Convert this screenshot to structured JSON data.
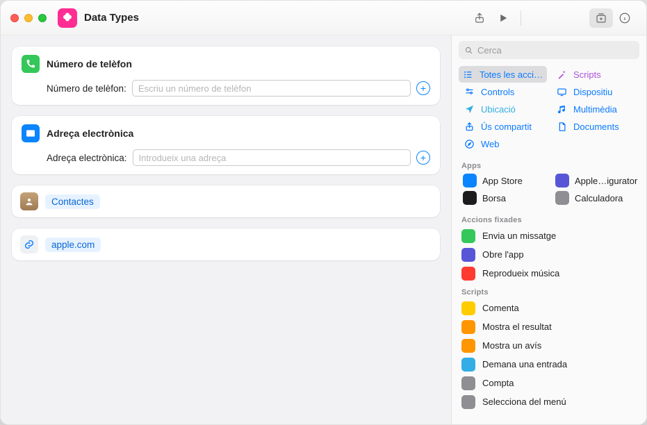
{
  "window": {
    "title": "Data Types"
  },
  "cards": {
    "phone": {
      "title": "Número de telèfon",
      "field_label": "Número de telèfon:",
      "placeholder": "Escriu un número de telèfon"
    },
    "email": {
      "title": "Adreça electrònica",
      "field_label": "Adreça electrònica:",
      "placeholder": "Introdueix una adreça"
    },
    "contacts_token": "Contactes",
    "url_token": "apple.com"
  },
  "panel": {
    "search_placeholder": "Cerca",
    "categories": [
      {
        "label": "Totes les acci…",
        "color": "blue",
        "icon": "list",
        "selected": true
      },
      {
        "label": "Scripts",
        "color": "purple",
        "icon": "wand",
        "selected": false
      },
      {
        "label": "Controls",
        "color": "blue",
        "icon": "sliders",
        "selected": false
      },
      {
        "label": "Dispositiu",
        "color": "blue",
        "icon": "device",
        "selected": false
      },
      {
        "label": "Ubicació",
        "color": "teal",
        "icon": "location",
        "selected": false
      },
      {
        "label": "Multimèdia",
        "color": "blue",
        "icon": "music",
        "selected": false
      },
      {
        "label": "Ús compartit",
        "color": "blue",
        "icon": "share",
        "selected": false
      },
      {
        "label": "Documents",
        "color": "blue",
        "icon": "doc",
        "selected": false
      },
      {
        "label": "Web",
        "color": "blue",
        "icon": "safari",
        "selected": false
      }
    ],
    "apps_header": "Apps",
    "apps": [
      {
        "label": "App Store",
        "color": "#0a84ff"
      },
      {
        "label": "Apple…igurator",
        "color": "#5856d6"
      },
      {
        "label": "Borsa",
        "color": "#1c1c1e"
      },
      {
        "label": "Calculadora",
        "color": "#8e8e93"
      }
    ],
    "pinned_header": "Accions fixades",
    "pinned": [
      {
        "label": "Envia un missatge",
        "color": "#34c759"
      },
      {
        "label": "Obre l'app",
        "color": "#5856d6"
      },
      {
        "label": "Reprodueix música",
        "color": "#ff3b30"
      }
    ],
    "scripts_header": "Scripts",
    "scripts": [
      {
        "label": "Comenta",
        "color": "#ffcc00"
      },
      {
        "label": "Mostra el resultat",
        "color": "#ff9500"
      },
      {
        "label": "Mostra un avís",
        "color": "#ff9500"
      },
      {
        "label": "Demana una entrada",
        "color": "#32ade6"
      },
      {
        "label": "Compta",
        "color": "#8e8e93"
      },
      {
        "label": "Selecciona del menú",
        "color": "#8e8e93"
      }
    ]
  }
}
